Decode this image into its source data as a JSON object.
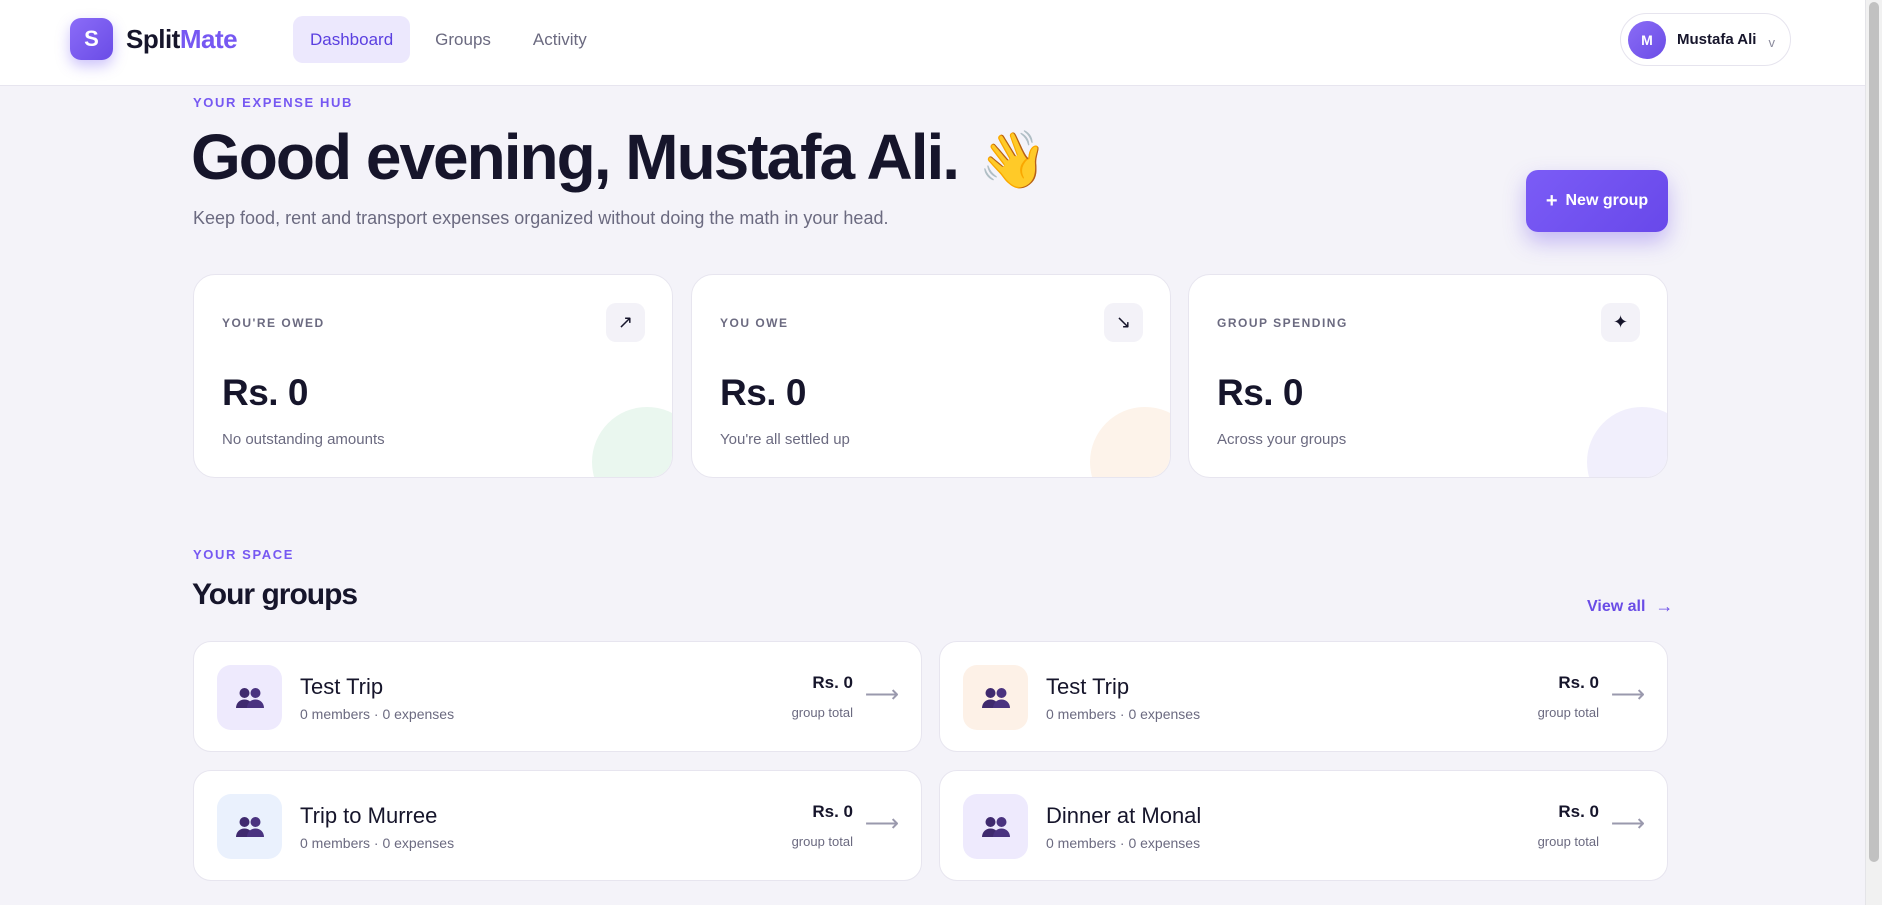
{
  "brand": {
    "logo_letter": "S",
    "name_part1": "Split",
    "name_part2": "Mate",
    "accent": "#7658f2"
  },
  "nav": {
    "items": [
      {
        "label": "Dashboard",
        "active": true
      },
      {
        "label": "Groups",
        "active": false
      },
      {
        "label": "Activity",
        "active": false
      }
    ]
  },
  "user": {
    "initial": "M",
    "name": "Mustafa Ali",
    "caret": "v"
  },
  "hero": {
    "eyebrow": "YOUR EXPENSE HUB",
    "greeting": "Good evening, Mustafa Ali.",
    "emoji": "👋",
    "subtitle": "Keep food, rent and transport expenses organized without doing the math in your head.",
    "new_group_label": "New group",
    "new_group_icon": "+"
  },
  "stats": [
    {
      "label": "YOU'RE OWED",
      "value": "Rs. 0",
      "note": "No outstanding amounts",
      "icon": "↗",
      "icon_name": "arrow-up-right-icon",
      "blob_color": "#eaf7ef"
    },
    {
      "label": "YOU OWE",
      "value": "Rs. 0",
      "note": "You're all settled up",
      "icon": "↘",
      "icon_name": "arrow-down-right-icon",
      "blob_color": "#fdf3ea"
    },
    {
      "label": "GROUP SPENDING",
      "value": "Rs. 0",
      "note": "Across your groups",
      "icon": "✦",
      "icon_name": "sparkle-icon",
      "blob_color": "#f1effc"
    }
  ],
  "groups_section": {
    "eyebrow": "YOUR SPACE",
    "title": "Your groups",
    "view_all_label": "View all",
    "view_all_arrow": "→"
  },
  "groups": [
    {
      "name": "Test Trip",
      "meta": "0 members · 0 expenses",
      "total": "Rs. 0",
      "total_label": "group total",
      "icon_bg": "#eeeafd"
    },
    {
      "name": "Test Trip",
      "meta": "0 members · 0 expenses",
      "total": "Rs. 0",
      "total_label": "group total",
      "icon_bg": "#fdf1e7"
    },
    {
      "name": "Trip to Murree",
      "meta": "0 members · 0 expenses",
      "total": "Rs. 0",
      "total_label": "group total",
      "icon_bg": "#eaf1fd"
    },
    {
      "name": "Dinner at Monal",
      "meta": "0 members · 0 expenses",
      "total": "Rs. 0",
      "total_label": "group total",
      "icon_bg": "#eeeafd"
    }
  ],
  "colors": {
    "text": "#16152b",
    "muted": "#6b6a80",
    "accent": "#7658f2",
    "page_bg": "#f4f3f9"
  }
}
